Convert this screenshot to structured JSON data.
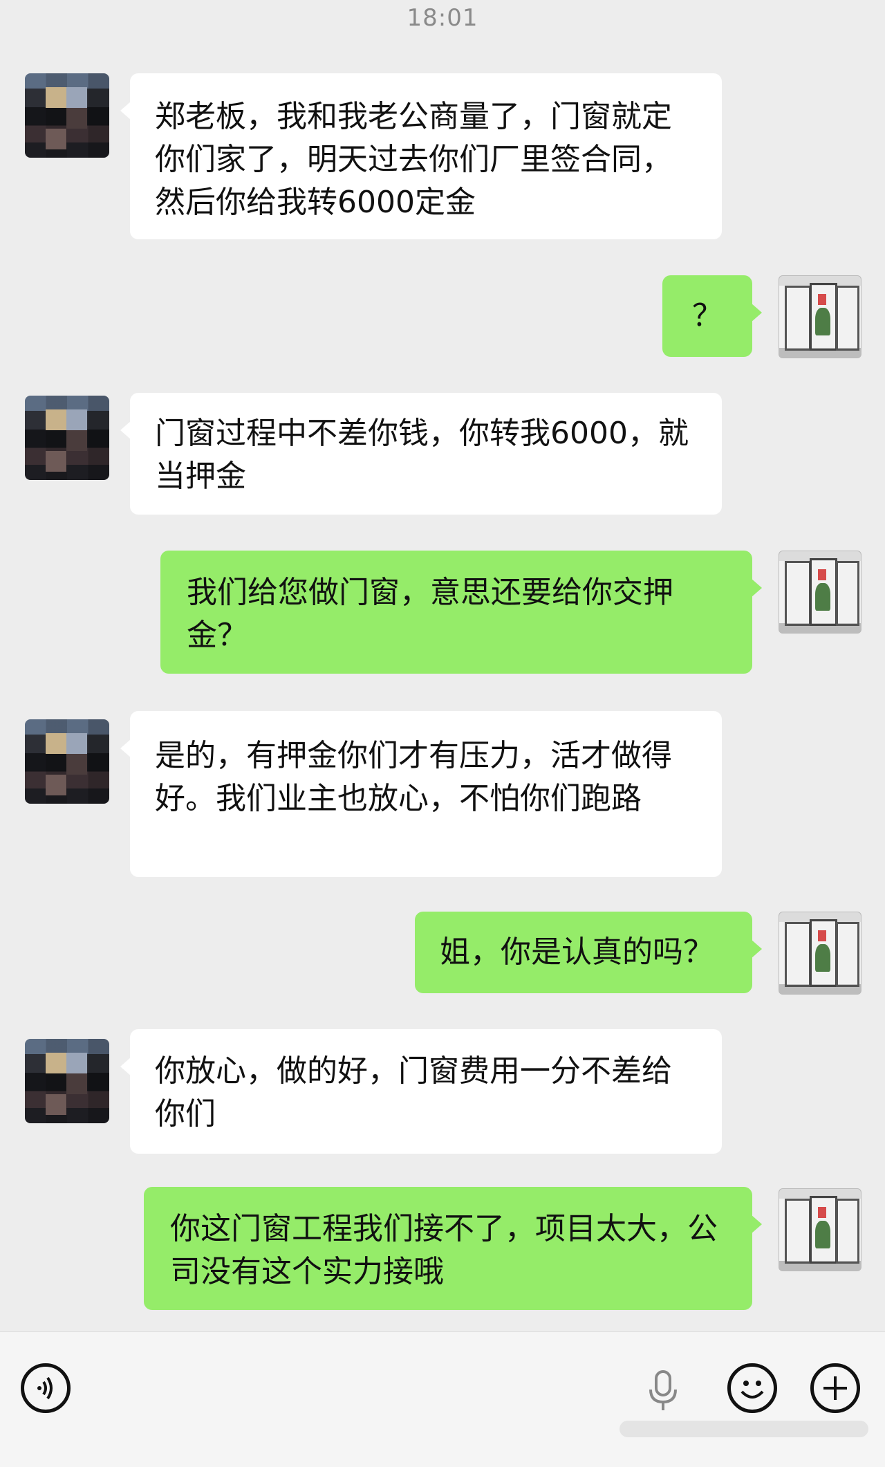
{
  "status_bar": {
    "time": "18:01"
  },
  "messages": [
    {
      "sender": "them",
      "text": "郑老板，我和我老公商量了，门窗就定你们家了，明天过去你们厂里签合同，然后你给我转6000定金"
    },
    {
      "sender": "me",
      "text": "？"
    },
    {
      "sender": "them",
      "text": "门窗过程中不差你钱，你转我6000，就当押金"
    },
    {
      "sender": "me",
      "text": "我们给您做门窗，意思还要给你交押金？"
    },
    {
      "sender": "them",
      "text": "是的，有押金你们才有压力，活才做得好。我们业主也放心，不怕你们跑路"
    },
    {
      "sender": "me",
      "text": "姐，你是认真的吗？"
    },
    {
      "sender": "them",
      "text": "你放心，做的好，门窗费用一分不差给你们"
    },
    {
      "sender": "me",
      "text": "你这门窗工程我们接不了，项目太大，公司没有这个实力接哦"
    }
  ],
  "input_bar": {
    "voice_icon": "voice-icon",
    "mic_icon": "microphone-icon",
    "emoji_icon": "emoji-icon",
    "plus_icon": "plus-icon"
  },
  "colors": {
    "background": "#ededed",
    "incoming_bubble": "#ffffff",
    "outgoing_bubble": "#95ec69"
  }
}
